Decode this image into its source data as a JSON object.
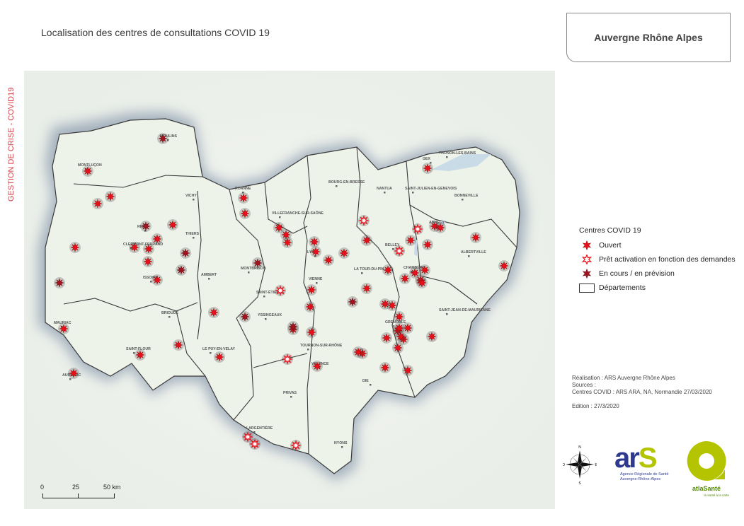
{
  "title": "Localisation des centres de consultations COVID 19",
  "region": "Auvergne Rhône Alpes",
  "side_label": "GESTION DE CRISE - COVID19",
  "legend": {
    "title": "Centres COVID 19",
    "items": [
      {
        "label": "Ouvert",
        "kind": "ouvert",
        "color": "#e8101a"
      },
      {
        "label": "Prêt activation en fonction des demandes",
        "kind": "pret",
        "color": "#e8101a"
      },
      {
        "label": "En cours / en prévision",
        "kind": "encours",
        "color": "#a01520"
      },
      {
        "label": "Départements",
        "kind": "dept"
      }
    ]
  },
  "credits": {
    "realisation": "Réalisation : ARS Auvergne Rhône Alpes",
    "sources_label": "Sources :",
    "sources": "Centres COVID : ARS ARA, NA, Normandie 27/03/2020",
    "edition": "Edition : 27/3/2020"
  },
  "scale": {
    "labels": [
      "0",
      "25",
      "50 km"
    ]
  },
  "compass_letters": [
    "N",
    "S",
    "O",
    "E"
  ],
  "logos": {
    "ars_main": "ar",
    "ars_s": "S",
    "ars_line1": "Agence Régionale de Santé",
    "ars_line2": "Auvergne-Rhône-Alpes",
    "atlas_name": "atlaSanté",
    "atlas_sub": "la santé à la carte"
  },
  "cities": [
    "MOULINS",
    "MONTLUÇON",
    "VICHY",
    "RIOM",
    "THIERS",
    "CLERMONT-FERRAND",
    "AMBERT",
    "ISSOIRE",
    "MAURIAC",
    "BRIOUDE",
    "SAINT-FLOUR",
    "AURILLAC",
    "ROANNE",
    "MONTBRISON",
    "SAINT-ÉTIENNE",
    "YSSINGEAUX",
    "LE PUY-EN-VELAY",
    "VILLEFRANCHE-SUR-SAÔNE",
    "LYON",
    "VIENNE",
    "TOURNON-SUR-RHÔNE",
    "VALENCE",
    "PRIVAS",
    "LARGENTIÈRE",
    "NYONS",
    "DIE",
    "BOURG-EN-BRESSE",
    "NANTUA",
    "BELLEY",
    "LA TOUR-DU-PIN",
    "GEX",
    "SAINT-JULIEN-EN-GENEVOIS",
    "THONON-LES-BAINS",
    "BONNEVILLE",
    "ANNECY",
    "ALBERTVILLE",
    "CHAMBÉRY",
    "SAINT-JEAN-DE-MAURIENNE",
    "GRENOBLE"
  ],
  "colors": {
    "ouvert": "#e8101a",
    "encours": "#a01520",
    "boundary": "#3a3a3a",
    "land": "#eef3ea"
  }
}
